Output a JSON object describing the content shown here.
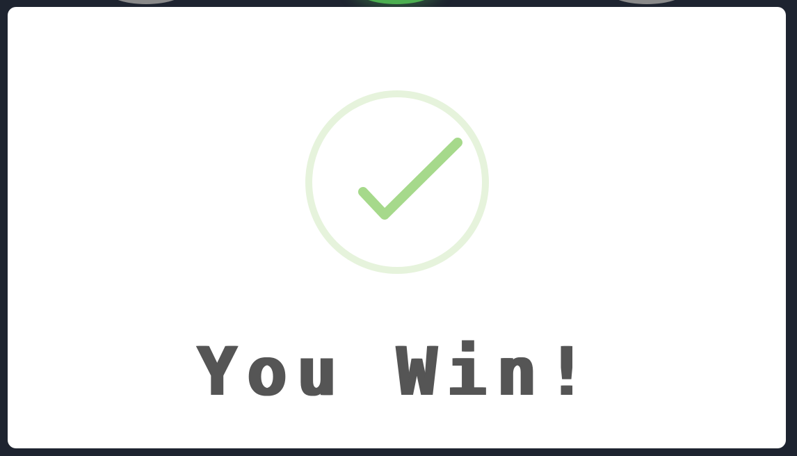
{
  "background": {
    "color": "#1e2430",
    "discs": [
      {
        "name": "left",
        "color": "#8a8a8a"
      },
      {
        "name": "center",
        "color": "#4caf50"
      },
      {
        "name": "right",
        "color": "#8a8a8a"
      }
    ]
  },
  "modal": {
    "background": "#ffffff",
    "icon": "check-circle-icon",
    "icon_colors": {
      "ring": "#e6f3dc",
      "check": "#a6d98b"
    },
    "title": "You Win!",
    "title_color": "#555555"
  }
}
